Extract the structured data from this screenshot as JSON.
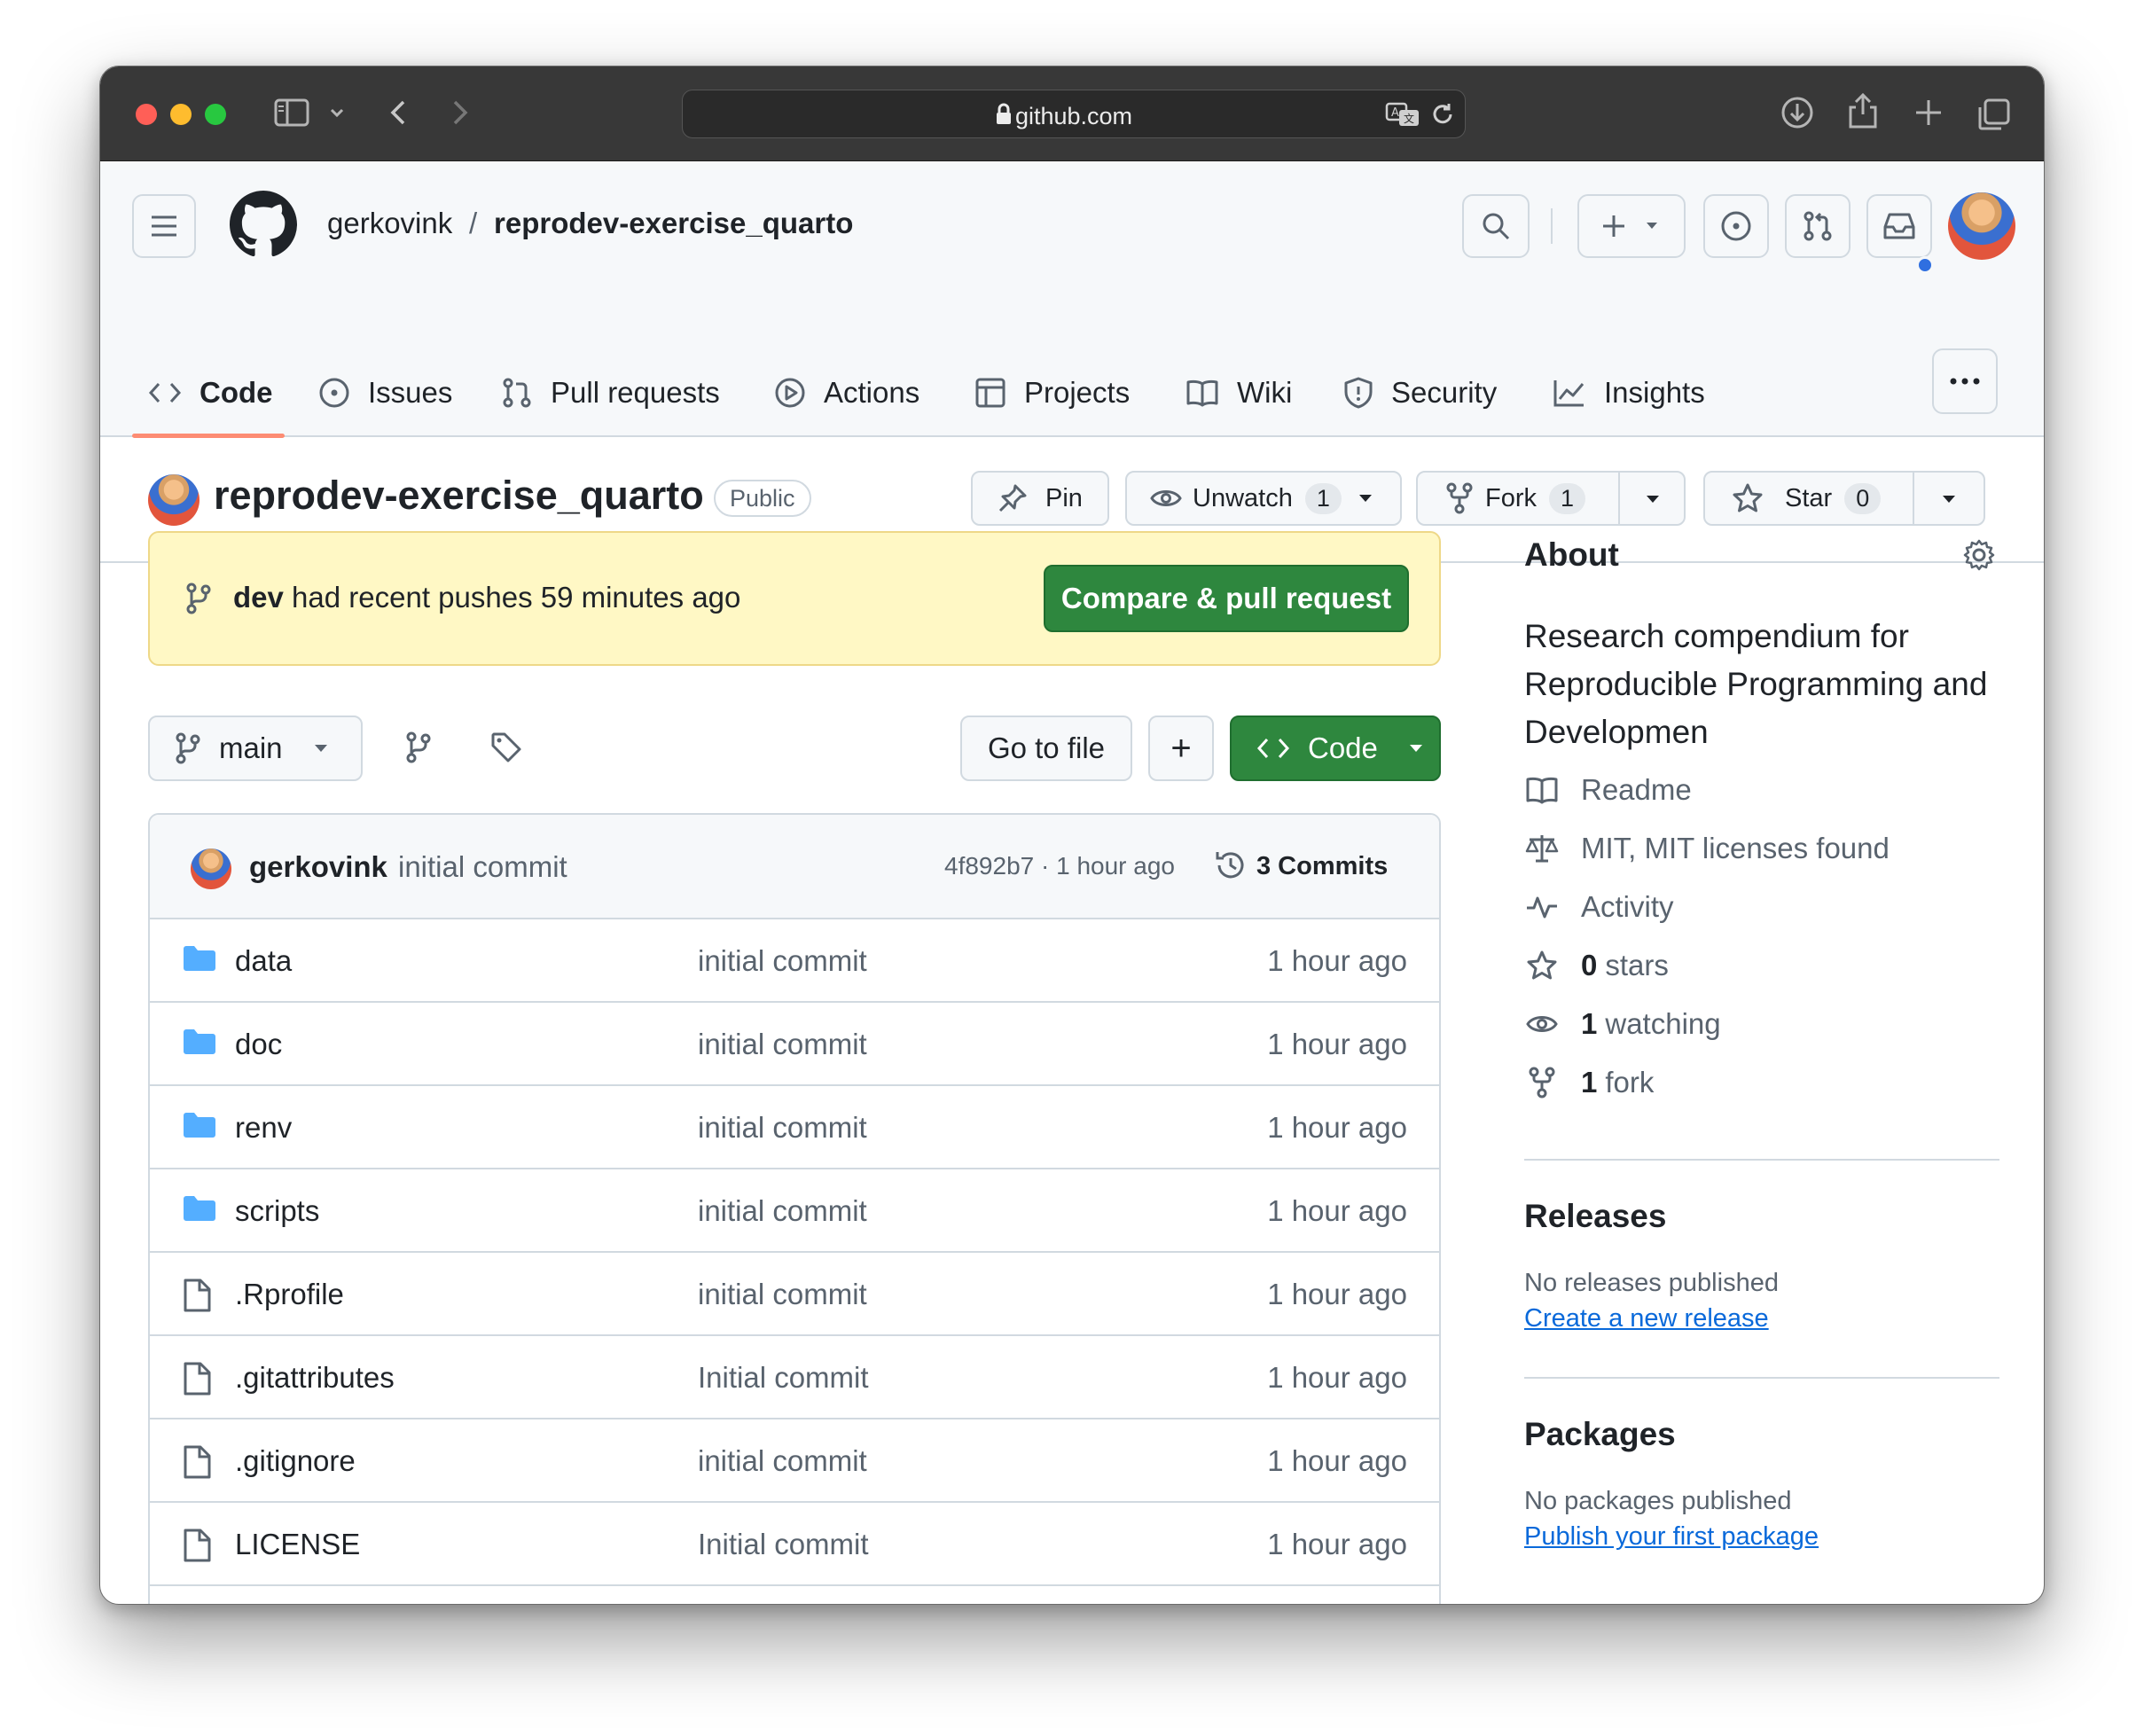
{
  "browser": {
    "url": "github.com"
  },
  "header": {
    "owner": "gerkovink",
    "separator": "/",
    "repo": "reprodev-exercise_quarto"
  },
  "tabs": [
    {
      "label": "Code",
      "icon": "code-icon",
      "active": true
    },
    {
      "label": "Issues",
      "icon": "issue-opened-icon"
    },
    {
      "label": "Pull requests",
      "icon": "git-pull-request-icon"
    },
    {
      "label": "Actions",
      "icon": "play-icon"
    },
    {
      "label": "Projects",
      "icon": "table-icon"
    },
    {
      "label": "Wiki",
      "icon": "book-icon"
    },
    {
      "label": "Security",
      "icon": "shield-icon"
    },
    {
      "label": "Insights",
      "icon": "graph-icon"
    }
  ],
  "repo_header": {
    "title": "reprodev-exercise_quarto",
    "visibility": "Public",
    "pin_label": "Pin",
    "watch_label": "Unwatch",
    "watch_count": "1",
    "fork_label": "Fork",
    "fork_count": "1",
    "star_label": "Star",
    "star_count": "0"
  },
  "banner": {
    "branch": "dev",
    "text": " had recent pushes 59 minutes ago",
    "button": "Compare & pull request"
  },
  "toolbar": {
    "branch": "main",
    "go_to_file": "Go to file",
    "add_symbol": "+",
    "code_label": "Code"
  },
  "latest_commit": {
    "author": "gerkovink",
    "message": "initial commit",
    "meta": "4f892b7 · 1 hour ago",
    "commits_label": "3 Commits"
  },
  "files": [
    {
      "name": "data",
      "type": "dir",
      "message": "initial commit",
      "time": "1 hour ago"
    },
    {
      "name": "doc",
      "type": "dir",
      "message": "initial commit",
      "time": "1 hour ago"
    },
    {
      "name": "renv",
      "type": "dir",
      "message": "initial commit",
      "time": "1 hour ago"
    },
    {
      "name": "scripts",
      "type": "dir",
      "message": "initial commit",
      "time": "1 hour ago"
    },
    {
      "name": ".Rprofile",
      "type": "file",
      "message": "initial commit",
      "time": "1 hour ago"
    },
    {
      "name": ".gitattributes",
      "type": "file",
      "message": "Initial commit",
      "time": "1 hour ago"
    },
    {
      "name": ".gitignore",
      "type": "file",
      "message": "initial commit",
      "time": "1 hour ago"
    },
    {
      "name": "LICENSE",
      "type": "file",
      "message": "Initial commit",
      "time": "1 hour ago"
    }
  ],
  "about": {
    "title": "About",
    "description": "Research compendium for Reproducible Programming and Developmen",
    "readme": "Readme",
    "license": "MIT, MIT licenses found",
    "activity": "Activity",
    "stars_count": "0",
    "stars_label": "stars",
    "watching_count": "1",
    "watching_label": "watching",
    "forks_count": "1",
    "forks_label": "fork"
  },
  "releases": {
    "title": "Releases",
    "empty": "No releases published",
    "link": "Create a new release"
  },
  "packages": {
    "title": "Packages",
    "empty": "No packages published",
    "link": "Publish your first package"
  },
  "colors": {
    "accent_green": "#2e873e",
    "link_blue": "#0969da",
    "tab_underline": "#fd8c73",
    "folder_blue": "#54aeff",
    "banner_bg": "#fff8c5",
    "notification_dot": "#2f6fe0"
  }
}
